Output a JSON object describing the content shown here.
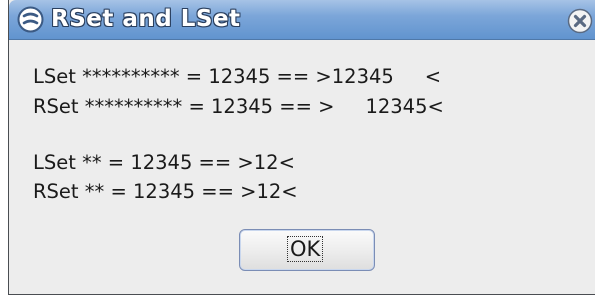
{
  "window": {
    "title": "RSet and LSet"
  },
  "message": {
    "lines": [
      "LSet ********** = 12345 == >12345     <",
      "RSet ********** = 12345 == >     12345<",
      "LSet ** = 12345 == >12<",
      "RSet ** = 12345 == >12<"
    ]
  },
  "buttons": {
    "ok_label": "OK"
  },
  "icons": {
    "title_icon": "app-menu-icon",
    "close_icon": "close-icon"
  },
  "colors": {
    "titlebar": "#6194cf",
    "dialog_background": "#ededed"
  }
}
